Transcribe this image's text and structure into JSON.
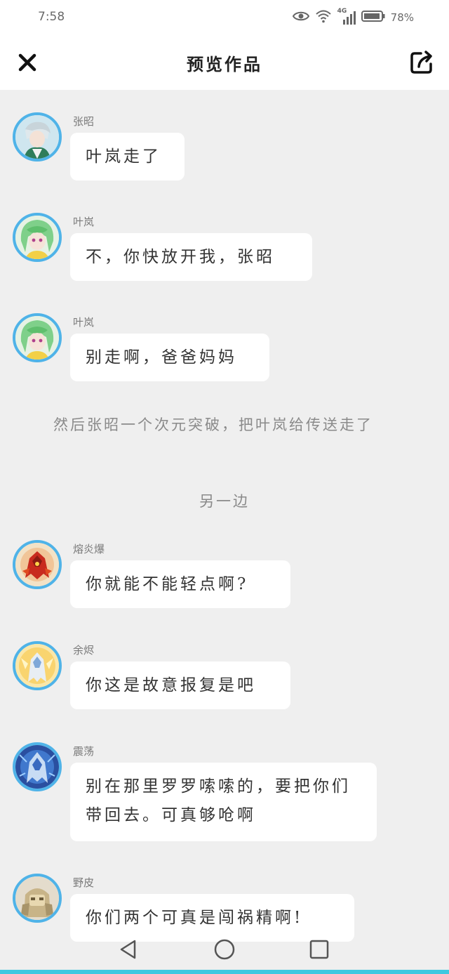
{
  "status_bar": {
    "time": "7:58",
    "network": "4G",
    "battery": "78%"
  },
  "header": {
    "title": "预览作品",
    "close_icon": "close-icon",
    "share_icon": "share-icon"
  },
  "colors": {
    "avatar_ring": "#4fb3e8",
    "background": "#efefef",
    "bottom_line": "#40c8e0"
  },
  "messages": [
    {
      "sender": "张昭",
      "text": "叶岚走了",
      "avatar": "avatar-zhangzhao"
    },
    {
      "sender": "叶岚",
      "text": "不，你快放开我，张昭",
      "avatar": "avatar-yelan"
    },
    {
      "sender": "叶岚",
      "text": "别走啊，爸爸妈妈",
      "avatar": "avatar-yelan"
    },
    {
      "sender": "熔炎爆",
      "text": "你就能不能轻点啊?",
      "avatar": "avatar-rongyanbao"
    },
    {
      "sender": "余烬",
      "text": "你这是故意报复是吧",
      "avatar": "avatar-yujin"
    },
    {
      "sender": "震荡",
      "text": "别在那里罗罗嗦嗦的，要把你们带回去。可真够呛啊",
      "avatar": "avatar-zhendang"
    },
    {
      "sender": "野皮",
      "text": "你们两个可真是闯祸精啊!",
      "avatar": "avatar-yepi"
    }
  ],
  "narration": "然后张昭一个次元突破，把叶岚给传送走了",
  "scene_break": "另一边",
  "nav": {
    "back_icon": "back-triangle-icon",
    "home_icon": "home-circle-icon",
    "recents_icon": "recents-square-icon"
  }
}
